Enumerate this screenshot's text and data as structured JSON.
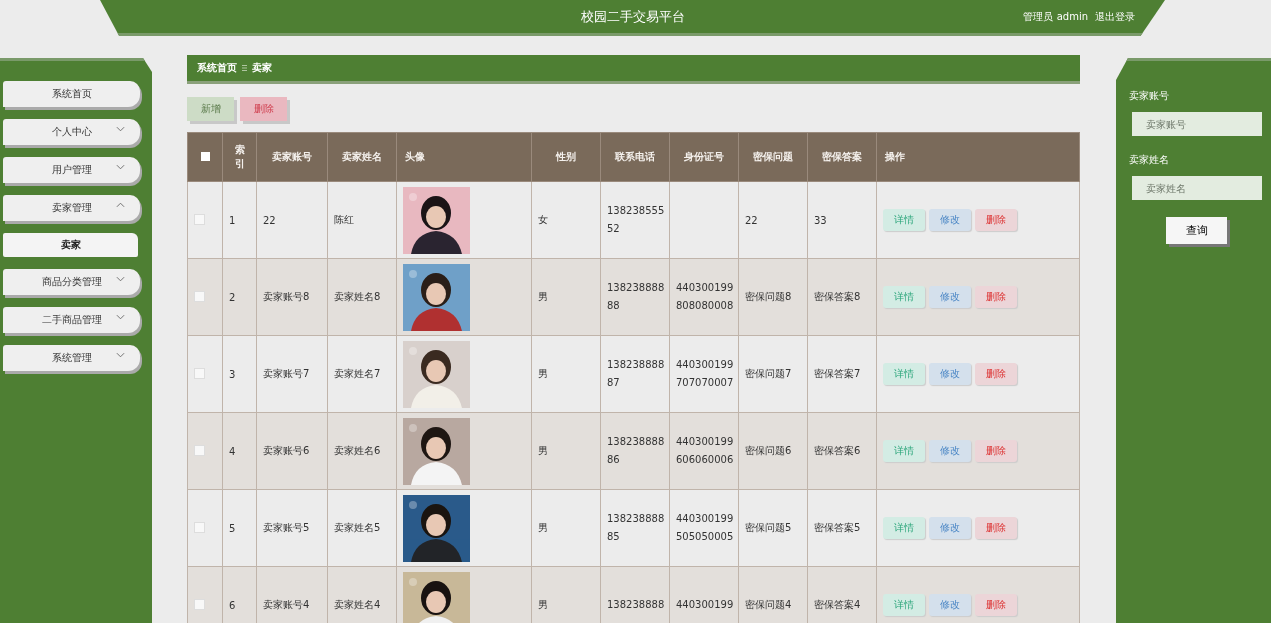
{
  "header": {
    "title": "校园二手交易平台",
    "user": "管理员 admin",
    "logout": "退出登录"
  },
  "sidebar": {
    "items": [
      {
        "label": "系统首页",
        "kind": "link"
      },
      {
        "label": "个人中心",
        "kind": "group",
        "expanded": false
      },
      {
        "label": "用户管理",
        "kind": "group",
        "expanded": false
      },
      {
        "label": "卖家管理",
        "kind": "group",
        "expanded": true,
        "children": [
          {
            "label": "卖家",
            "selected": true
          }
        ]
      },
      {
        "label": "商品分类管理",
        "kind": "group",
        "expanded": false
      },
      {
        "label": "二手商品管理",
        "kind": "group",
        "expanded": false
      },
      {
        "label": "系统管理",
        "kind": "group",
        "expanded": false
      }
    ]
  },
  "breadcrumb": [
    "系统首页",
    "卖家"
  ],
  "toolbar": [
    {
      "kind": "add",
      "label": "新增"
    },
    {
      "kind": "delete",
      "label": "删除"
    }
  ],
  "table": {
    "select_all": {
      "checked": false
    },
    "columns": [
      "索引",
      "卖家账号",
      "卖家姓名",
      "头像",
      "性别",
      "联系电话",
      "身份证号",
      "密保问题",
      "密保答案",
      "操作"
    ],
    "rows": [
      {
        "checked": false,
        "index": "1",
        "account": "22",
        "name": "陈红",
        "gender": "女",
        "phone": "13823855552",
        "question": "22",
        "answer": "33",
        "actions": [
          {
            "kind": "detail",
            "label": "详情"
          },
          {
            "kind": "edit",
            "label": "修改"
          },
          {
            "kind": "delete",
            "label": "删除"
          }
        ]
      },
      {
        "checked": false,
        "index": "2",
        "account": "卖家账号8",
        "name": "卖家姓名8",
        "gender": "男",
        "phone": "13823888888",
        "id_number": "440300199808080008",
        "question": "密保问题8",
        "answer": "密保答案8",
        "actions": [
          {
            "kind": "detail",
            "label": "详情"
          },
          {
            "kind": "edit",
            "label": "修改"
          },
          {
            "kind": "delete",
            "label": "删除"
          }
        ]
      },
      {
        "checked": false,
        "index": "3",
        "account": "卖家账号7",
        "name": "卖家姓名7",
        "gender": "男",
        "phone": "13823888887",
        "id_number": "440300199707070007",
        "question": "密保问题7",
        "answer": "密保答案7",
        "actions": [
          {
            "kind": "detail",
            "label": "详情"
          },
          {
            "kind": "edit",
            "label": "修改"
          },
          {
            "kind": "delete",
            "label": "删除"
          }
        ]
      },
      {
        "checked": false,
        "index": "4",
        "account": "卖家账号6",
        "name": "卖家姓名6",
        "gender": "男",
        "phone": "13823888886",
        "id_number": "440300199606060006",
        "question": "密保问题6",
        "answer": "密保答案6",
        "actions": [
          {
            "kind": "detail",
            "label": "详情"
          },
          {
            "kind": "edit",
            "label": "修改"
          },
          {
            "kind": "delete",
            "label": "删除"
          }
        ]
      },
      {
        "checked": false,
        "index": "5",
        "account": "卖家账号5",
        "name": "卖家姓名5",
        "gender": "男",
        "phone": "13823888885",
        "id_number": "440300199505050005",
        "question": "密保问题5",
        "answer": "密保答案5",
        "actions": [
          {
            "kind": "detail",
            "label": "详情"
          },
          {
            "kind": "edit",
            "label": "修改"
          },
          {
            "kind": "delete",
            "label": "删除"
          }
        ]
      },
      {
        "checked": false,
        "index": "6",
        "account": "卖家账号4",
        "name": "卖家姓名4",
        "gender": "男",
        "phone": "138238888",
        "id_number": "440300199",
        "question": "密保问题4",
        "answer": "密保答案4",
        "actions": [
          {
            "kind": "detail",
            "label": "详情"
          },
          {
            "kind": "edit",
            "label": "修改"
          },
          {
            "kind": "delete",
            "label": "删除"
          }
        ]
      }
    ]
  },
  "search": {
    "fields": [
      {
        "label": "卖家账号",
        "placeholder": "卖家账号"
      },
      {
        "label": "卖家姓名",
        "placeholder": "卖家姓名"
      }
    ],
    "button": "查询"
  }
}
